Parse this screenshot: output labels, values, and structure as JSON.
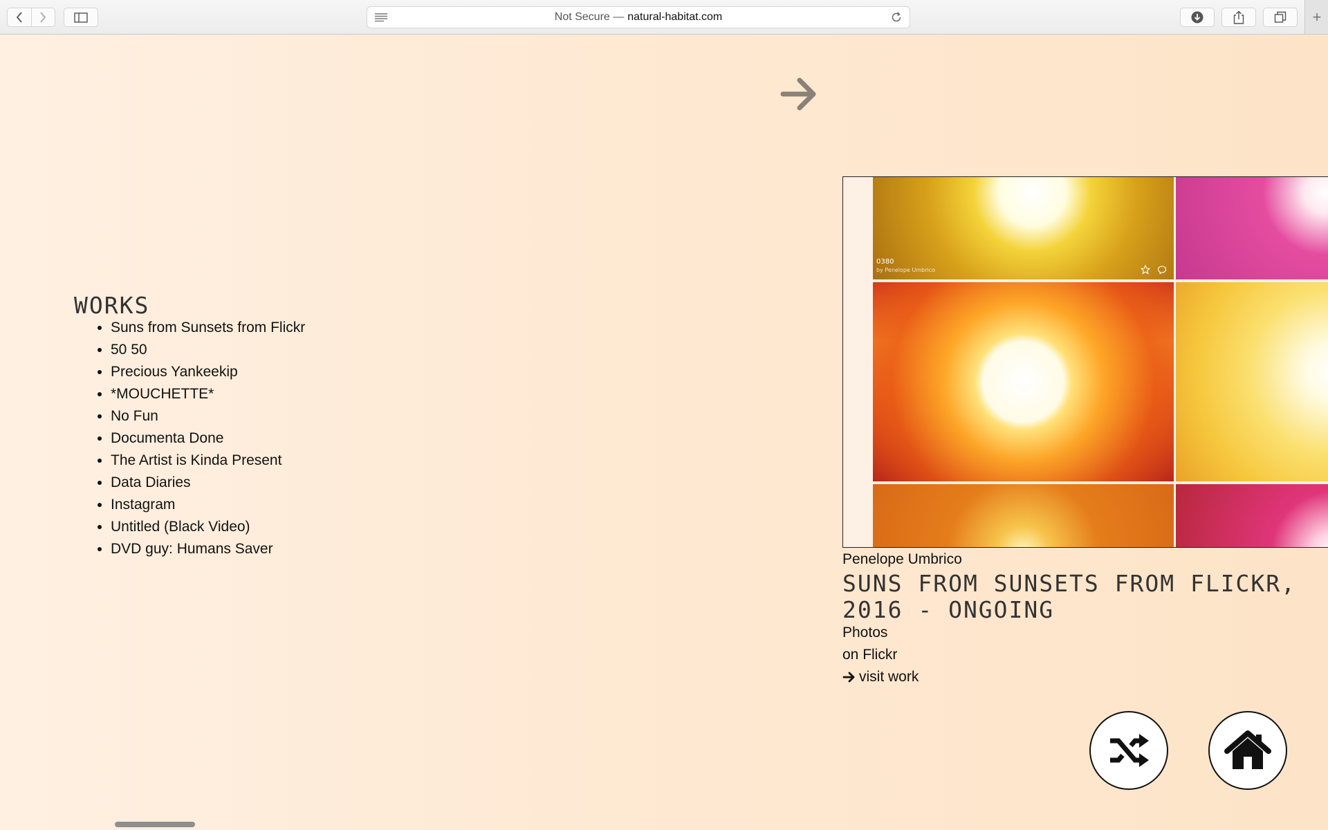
{
  "browser": {
    "address_prefix": "Not Secure —",
    "address_domain": "natural-habitat.com",
    "new_tab_label": "+"
  },
  "works": {
    "title": "WORKS",
    "items": [
      "Suns from Sunsets from Flickr",
      "50 50",
      "Precious Yankeekip",
      "*MOUCHETTE*",
      "No Fun",
      "Documenta Done",
      "The Artist is Kinda Present",
      "Data Diaries",
      "Instagram",
      "Untitled (Black Video)",
      "DVD guy: Humans Saver"
    ]
  },
  "feature": {
    "tile_caption_number": "0380",
    "tile_caption_by": "by Penelope Umbrico",
    "artist": "Penelope Umbrico",
    "title": "SUNS FROM SUNSETS FROM FLICKR,\n2016 - ONGOING",
    "medium": "Photos",
    "platform": "on Flickr",
    "visit_label": "visit work"
  },
  "icons": {
    "next": "arrow-right-icon",
    "shuffle": "shuffle-icon",
    "home": "home-icon"
  }
}
